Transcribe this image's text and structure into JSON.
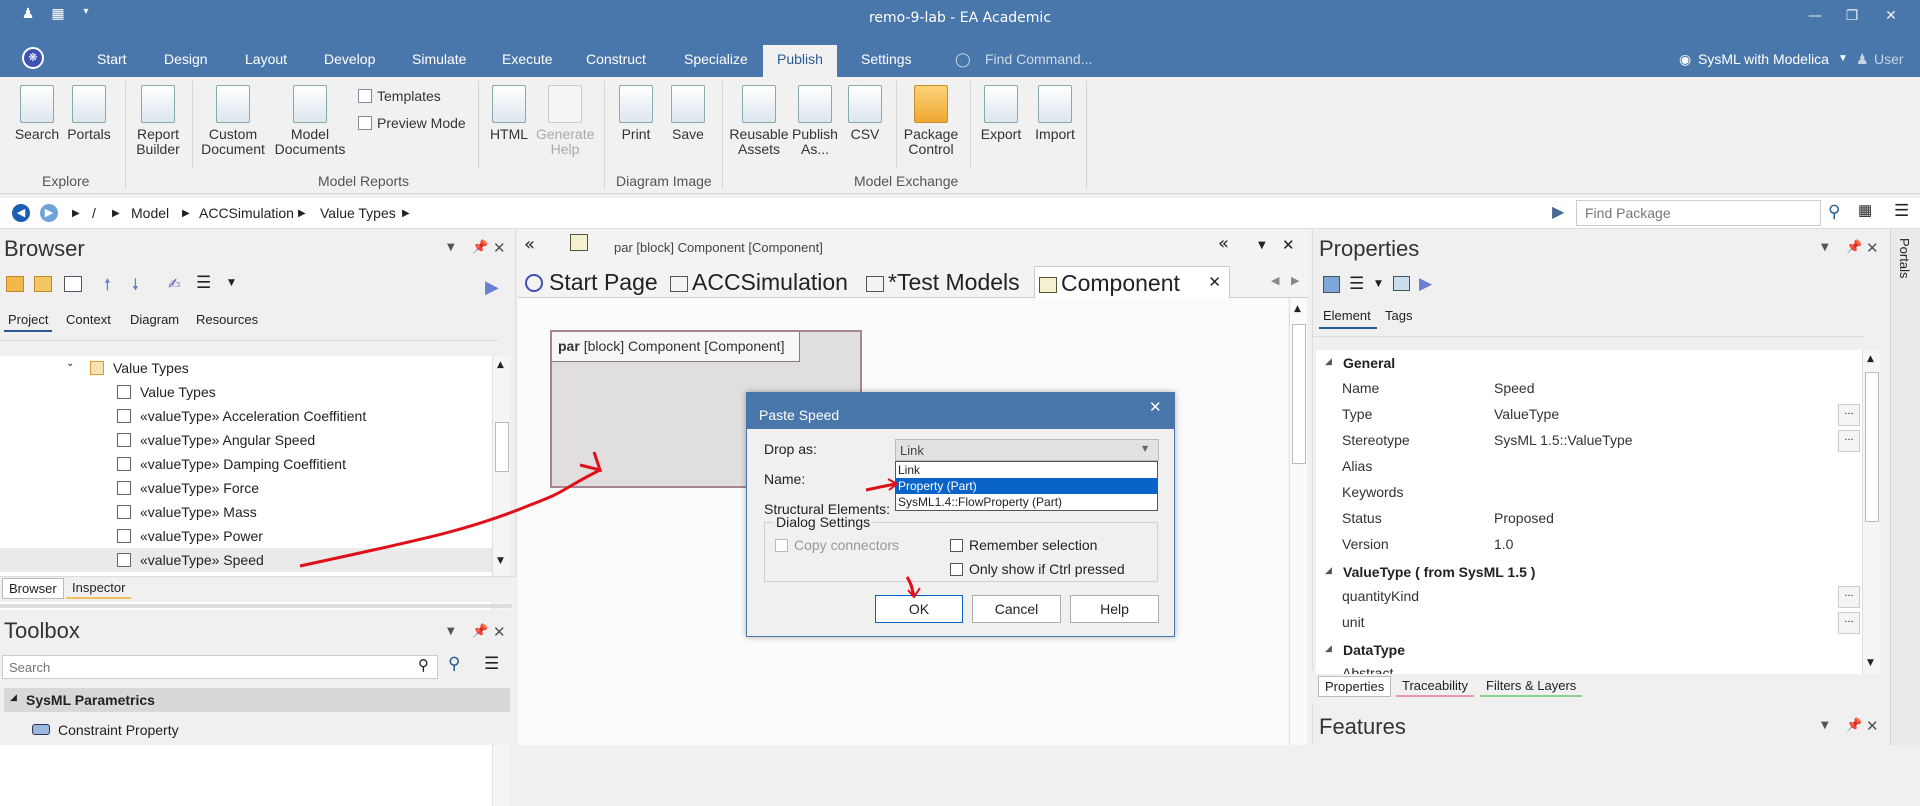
{
  "window": {
    "title": "remo-9-lab - EA Academic"
  },
  "ribbon_tabs": [
    "Start",
    "Design",
    "Layout",
    "Develop",
    "Simulate",
    "Execute",
    "Construct",
    "Specialize",
    "Publish",
    "Settings"
  ],
  "active_tab": "Publish",
  "find_command": "Find Command...",
  "perspective": "SysML with Modelica",
  "user": "User",
  "ribbon": {
    "explore": {
      "search": "Search",
      "portals": "Portals",
      "group": "Explore"
    },
    "reports": {
      "report_builder": "Report Builder",
      "custom_document": "Custom Document",
      "model_documents": "Model Documents",
      "templates": "Templates",
      "preview_mode": "Preview Mode",
      "group": "Model Reports"
    },
    "html": "HTML",
    "generate_help": "Generate Help",
    "image": {
      "print": "Print",
      "save": "Save",
      "group": "Diagram Image"
    },
    "exchange": {
      "reusable_assets": "Reusable Assets",
      "publish_as": "Publish As...",
      "csv": "CSV",
      "package_control": "Package Control",
      "export": "Export",
      "import": "Import",
      "group": "Model Exchange"
    }
  },
  "breadcrumb": [
    "/",
    "Model",
    "ACCSimulation",
    "Value Types"
  ],
  "find_package": "Find Package",
  "browser": {
    "title": "Browser",
    "tabs": [
      "Project",
      "Context",
      "Diagram",
      "Resources"
    ],
    "folder": "Value Types",
    "items": [
      "Value Types",
      "«valueType» Acceleration Coeffitient",
      "«valueType» Angular Speed",
      "«valueType» Damping Coeffitient",
      "«valueType» Force",
      "«valueType» Mass",
      "«valueType» Power",
      "«valueType» Speed"
    ],
    "bottom_tabs": [
      "Browser",
      "Inspector"
    ]
  },
  "toolbox": {
    "title": "Toolbox",
    "search_placeholder": "Search",
    "group": "SysML Parametrics",
    "item": "Constraint Property"
  },
  "diagram": {
    "header": "par [block] Component [Component]",
    "tabs": [
      "Start Page",
      "ACCSimulation",
      "*Test Models",
      "Component"
    ],
    "frame_keyword": "par",
    "frame_label": "[block] Component [Component]"
  },
  "properties": {
    "title": "Properties",
    "tabs": [
      "Element",
      "Tags"
    ],
    "general": "General",
    "rows": [
      {
        "k": "Name",
        "v": "Speed"
      },
      {
        "k": "Type",
        "v": "ValueType"
      },
      {
        "k": "Stereotype",
        "v": "SysML 1.5::ValueType"
      },
      {
        "k": "Alias",
        "v": ""
      },
      {
        "k": "Keywords",
        "v": ""
      },
      {
        "k": "Status",
        "v": "Proposed"
      },
      {
        "k": "Version",
        "v": "1.0"
      }
    ],
    "valuetype_section": "ValueType  ( from SysML 1.5 )",
    "vt_rows": [
      {
        "k": "quantityKind",
        "v": ""
      },
      {
        "k": "unit",
        "v": ""
      }
    ],
    "datatype_section": "DataType",
    "abstract": "Abstract",
    "bottom_tabs": [
      "Properties",
      "Traceability",
      "Filters & Layers"
    ]
  },
  "features": {
    "title": "Features"
  },
  "portals_side": "Portals",
  "dialog": {
    "title": "Paste Speed",
    "drop_as_label": "Drop as:",
    "drop_as_value": "Link",
    "options": [
      "Link",
      "Property (Part)",
      "SysML1.4::FlowProperty (Part)"
    ],
    "selected_option": "Property (Part)",
    "name_label": "Name:",
    "structural_label": "Structural Elements:",
    "settings_group": "Dialog Settings",
    "copy_connectors": "Copy connectors",
    "remember_selection": "Remember selection",
    "only_ctrl": "Only show if Ctrl pressed",
    "ok": "OK",
    "cancel": "Cancel",
    "help": "Help"
  },
  "colors": {
    "titlebar": "#4a77ab",
    "selection": "#0a64c8",
    "annotation_arrow": "#e0101a"
  }
}
